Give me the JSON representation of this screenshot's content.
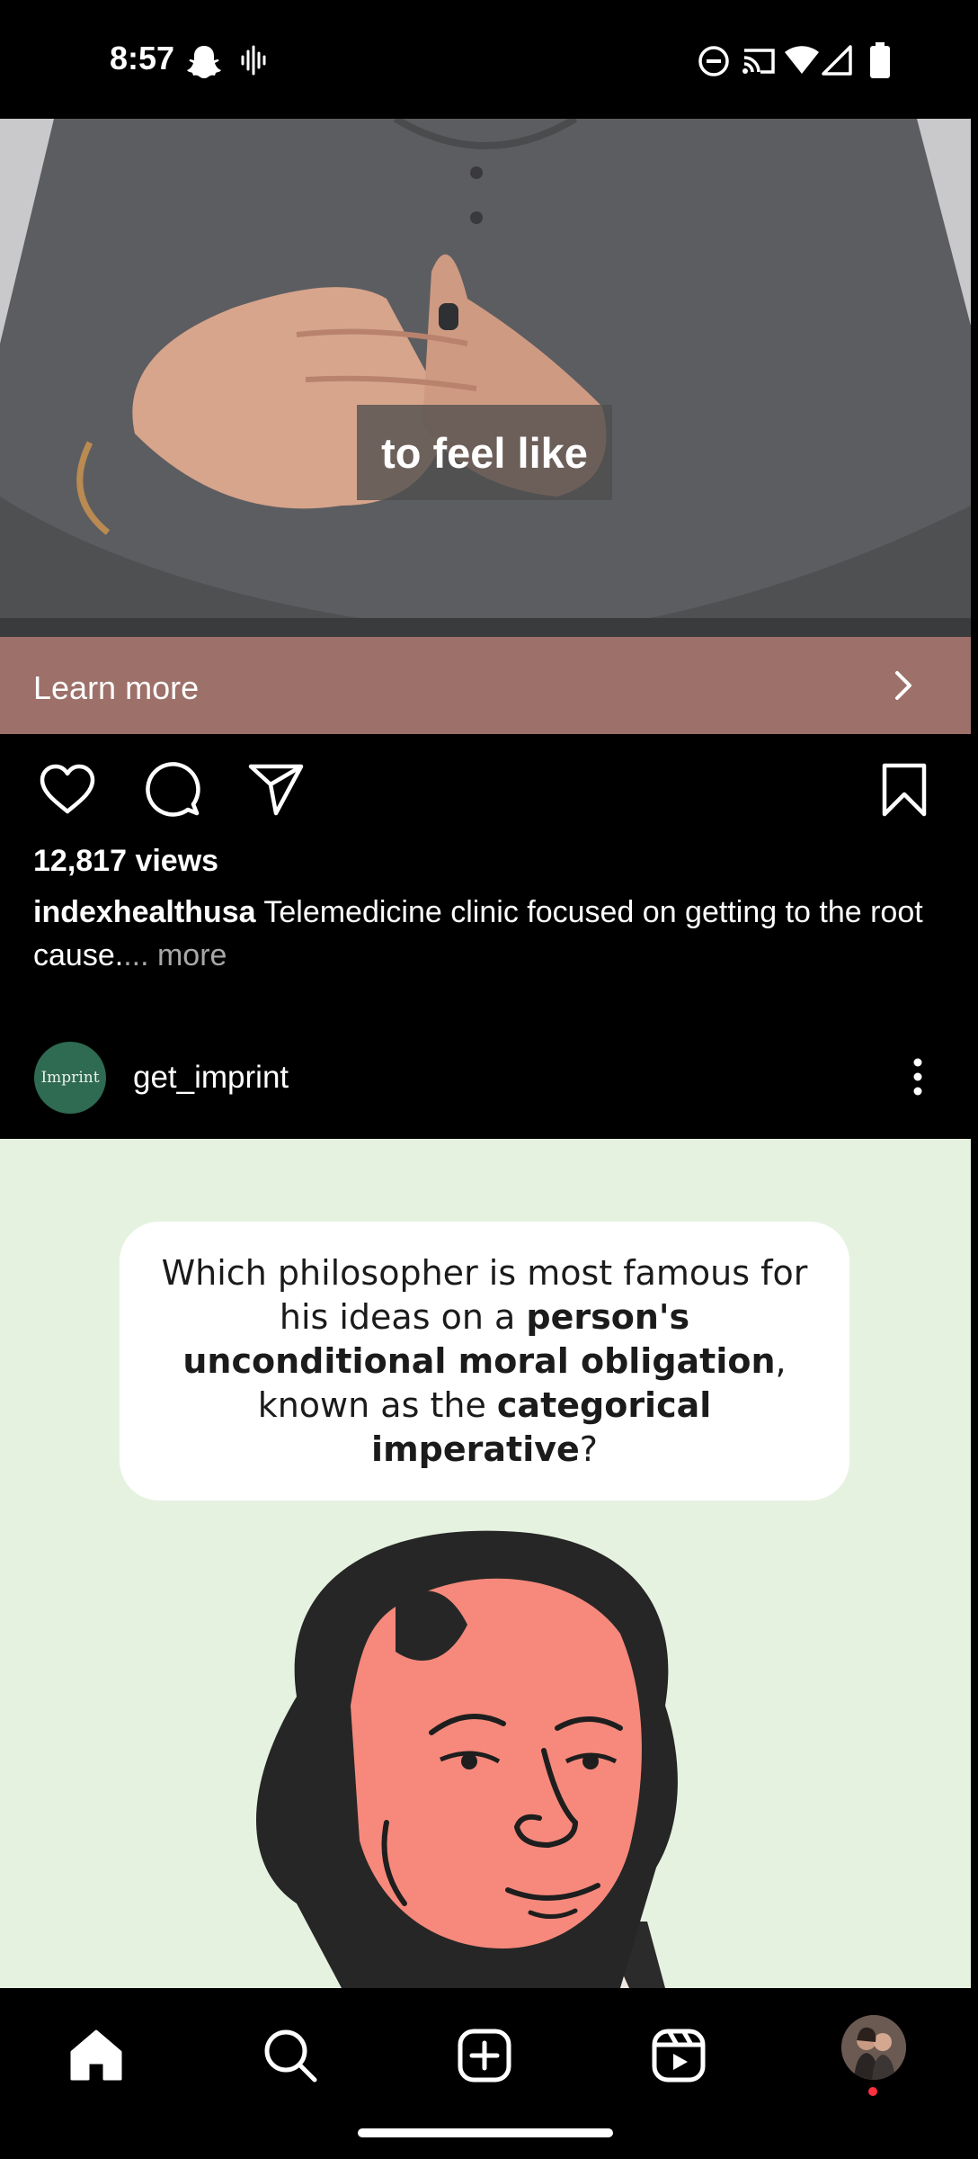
{
  "status_bar": {
    "time": "8:57",
    "left_icons": [
      "snapchat-icon",
      "audio-waveform-icon"
    ],
    "right_icons": [
      "do-not-disturb-icon",
      "cast-icon",
      "wifi-icon",
      "cell-signal-icon",
      "battery-icon"
    ]
  },
  "post1": {
    "video_caption": "to feel like",
    "cta_label": "Learn more",
    "views": "12,817 views",
    "username": "indexhealthusa",
    "caption": "Telemedicine clinic focused on getting to the root cause.",
    "more_label": "... more"
  },
  "post2": {
    "avatar_text": "Imprint",
    "username": "get_imprint",
    "question": {
      "part1": "Which philosopher is most famous for his ideas on a ",
      "bold1": "person's unconditional moral obligation",
      "part2": ", known as the ",
      "bold2": "categorical imperative",
      "part3": "?"
    }
  },
  "bottom_nav": {
    "items": [
      "home-icon",
      "search-icon",
      "create-icon",
      "reels-icon",
      "profile-avatar"
    ]
  },
  "colors": {
    "cta_background": "#9d7069",
    "post_background": "#e6f2e0",
    "avatar_background": "#2f6a52",
    "notification_dot": "#ff3040"
  }
}
